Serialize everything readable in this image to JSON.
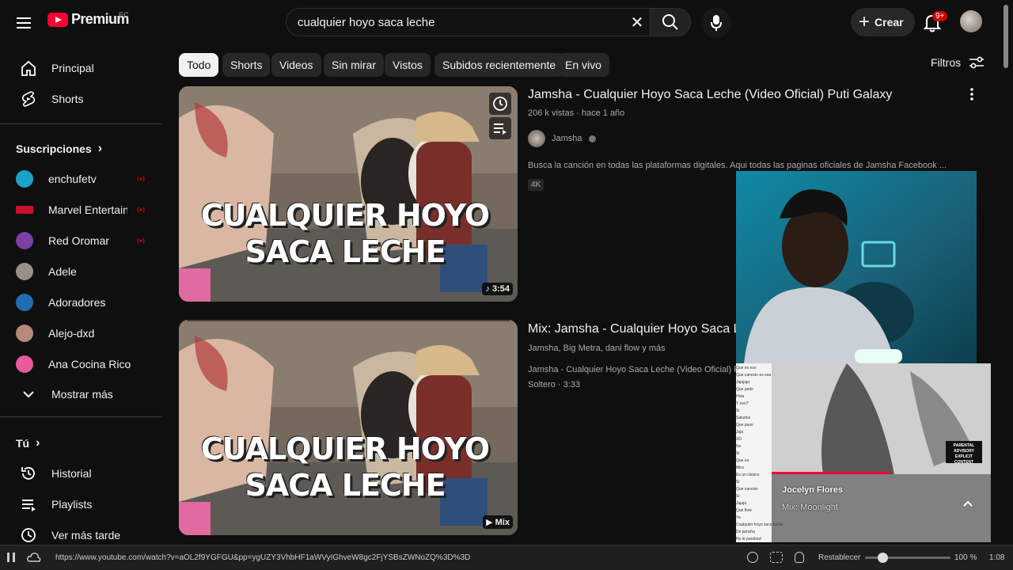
{
  "header": {
    "logo_text": "Premium",
    "country_code": "EC",
    "search_value": "cualquier hoyo saca leche",
    "create_label": "Crear",
    "notification_count": "9+"
  },
  "sidebar": {
    "main": [
      {
        "label": "Principal",
        "icon": "home-icon"
      },
      {
        "label": "Shorts",
        "icon": "shorts-icon"
      }
    ],
    "subscriptions_title": "Suscripciones",
    "subscriptions": [
      {
        "label": "enchufetv",
        "live": true,
        "color": "#1aa3c9"
      },
      {
        "label": "Marvel Entertain...",
        "live": true,
        "color": "#c8102e"
      },
      {
        "label": "Red Oromar",
        "live": true,
        "color": "#7b3fa8"
      },
      {
        "label": "Adele",
        "live": false,
        "color": "#9a8f86"
      },
      {
        "label": "Adoradores",
        "live": false,
        "color": "#1f6fb0"
      },
      {
        "label": "Alejo-dxd",
        "live": false,
        "color": "#b58a7a"
      },
      {
        "label": "Ana Cocina Rico",
        "live": false,
        "color": "#e85a9a"
      }
    ],
    "show_more": "Mostrar más",
    "you_title": "Tú",
    "you_items": [
      {
        "label": "Historial",
        "icon": "history-icon"
      },
      {
        "label": "Playlists",
        "icon": "playlist-icon"
      },
      {
        "label": "Ver más tarde",
        "icon": "clock-icon"
      }
    ]
  },
  "chips": [
    "Todo",
    "Shorts",
    "Videos",
    "Sin mirar",
    "Vistos",
    "Subidos recientemente",
    "En vivo"
  ],
  "filters_label": "Filtros",
  "results": [
    {
      "thumb_text_line1": "CUALQUIER HOYO",
      "thumb_text_line2": "SACA LECHE",
      "duration": "3:54",
      "title": "Jamsha - Cualquier Hoyo Saca Leche (Video Oficial) Puti Galaxy",
      "meta": "206 k vistas · hace 1 año",
      "channel": "Jamsha",
      "description": "Busca la canción en todas las plataformas digitales. Aqui todas las paginas oficiales de Jamsha Facebook ...",
      "badge": "4K"
    },
    {
      "thumb_text_line1": "CUALQUIER HOYO",
      "thumb_text_line2": "SACA LECHE",
      "duration": "Mix",
      "title": "Mix: Jamsha - Cualquier Hoyo Saca L",
      "meta": "Jamsha, Big Metra, dani flow y más",
      "line2": "Jamsha - Cualquier Hoyo Saca Leche (Video Oficial) Puti Galaxy",
      "line3": "Soltero · 3:33"
    }
  ],
  "mini_player": {
    "title": "Jocelyn Flores",
    "subtitle": "Mix: Moonlight",
    "advisory": "PARENTAL ADVISORY EXPLICIT CONTENT"
  },
  "chat_lines": [
    "Que es eso",
    "Que cancion es esa",
    "Jajajaja",
    "Que pedo",
    "Hola",
    "Y eso?",
    "Si",
    "Saludos",
    "Que paso",
    "Jaja",
    "XD",
    "No",
    "Si",
    "Que es",
    "Mira",
    "Es un clasico",
    "Si",
    "Que cancion",
    "Si",
    "Jajaja",
    "Que flow",
    "Ya",
    "Cualquier hoyo saca leche",
    "De jamsha",
    "No le parabas!"
  ],
  "statusbar": {
    "url": "https://www.youtube.com/watch?v=aOL2f9YGFGU&pp=ygUZY3VhbHF1aWVyIGhveW8gc2FjYSBsZWNoZQ%3D%3D",
    "reset_label": "Restablecer",
    "zoom": "100 %",
    "zoom_fraction": 0.2,
    "time": "1:08"
  },
  "colors": {
    "background": "#0f0f0f",
    "brand_red": "#ff0033",
    "chip_bg": "#272727",
    "live_red": "#cc0000"
  }
}
